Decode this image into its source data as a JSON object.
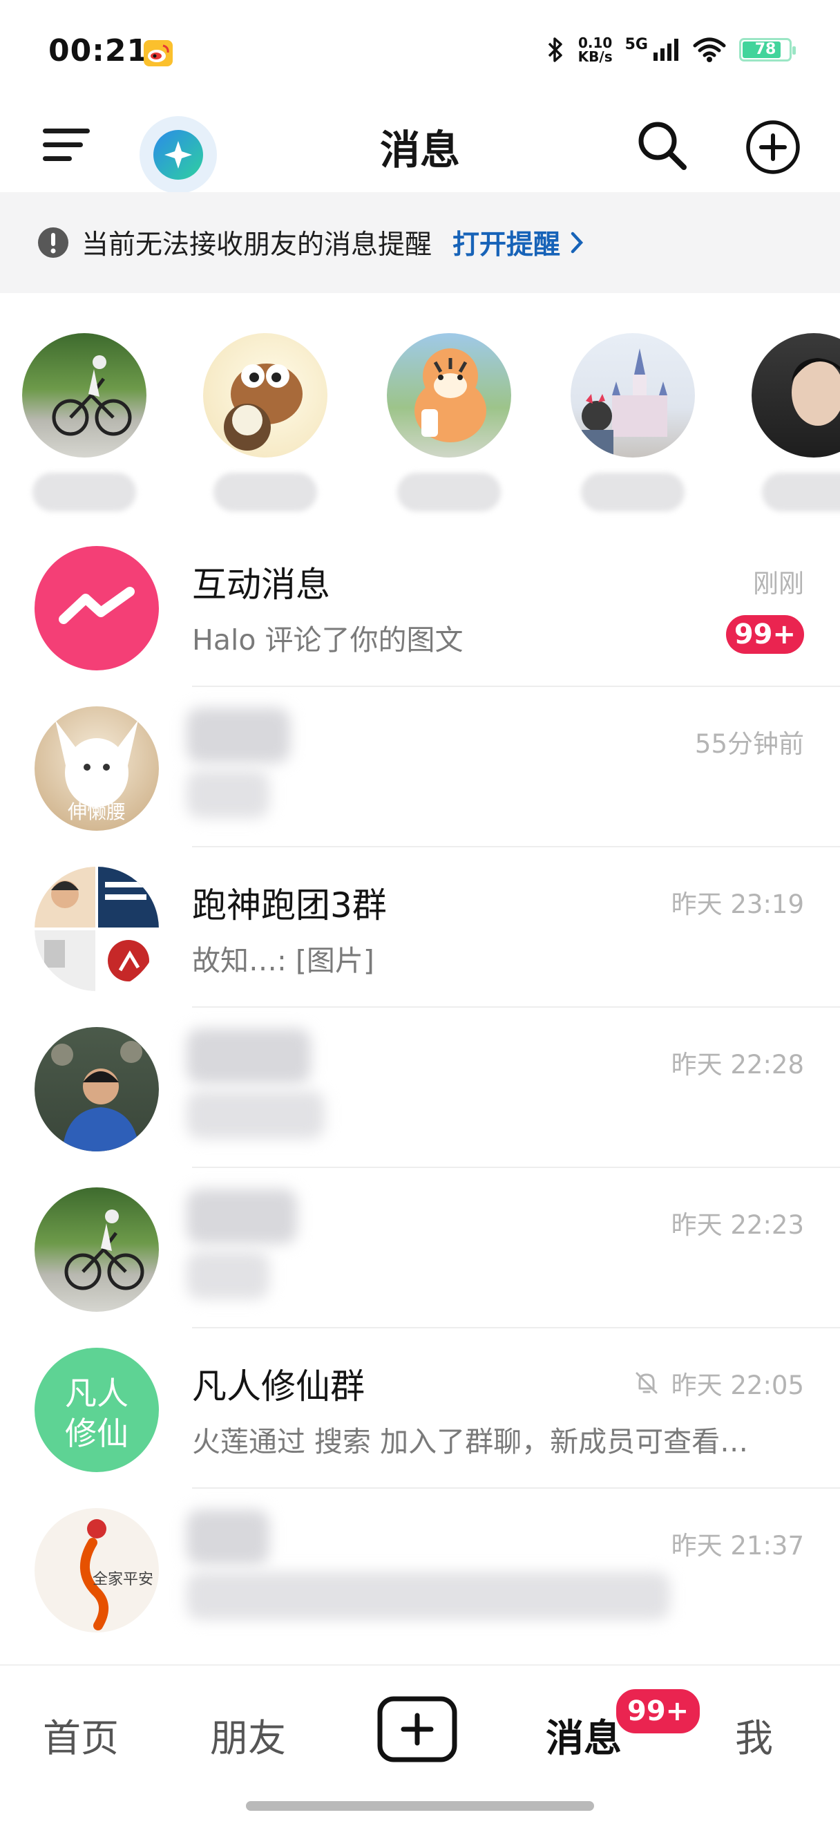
{
  "status_bar": {
    "time": "00:21",
    "speed_value": "0.10",
    "speed_unit": "KB/s",
    "network": "5G",
    "battery": "78"
  },
  "header": {
    "title": "消息"
  },
  "notice": {
    "text": "当前无法接收朋友的消息提醒",
    "action": "打开提醒"
  },
  "conversations": [
    {
      "name": "互动消息",
      "preview": "Halo 评论了你的图文",
      "time": "刚刚",
      "badge": "99+"
    },
    {
      "name": "",
      "preview": "",
      "time": "55分钟前"
    },
    {
      "name": "跑神跑团3群",
      "preview": "故知…: [图片]",
      "time": "昨天 23:19"
    },
    {
      "name": "",
      "preview": "",
      "time": "昨天 22:28"
    },
    {
      "name": "",
      "preview": "",
      "time": "昨天 22:23"
    },
    {
      "name": "凡人修仙群",
      "preview": "火莲通过 搜索 加入了群聊，新成员可查看…",
      "time": "昨天 22:05",
      "avatar_text": "凡人修仙"
    },
    {
      "name": "",
      "preview": "",
      "time": "昨天 21:37"
    }
  ],
  "avatar_overlays": {
    "cat_caption": "伸懒腰",
    "family_caption": "全家平安"
  },
  "bottom_nav": {
    "home": "首页",
    "friends": "朋友",
    "messages": "消息",
    "messages_badge": "99+",
    "me": "我"
  },
  "colors": {
    "accent_red": "#ea2450",
    "link_blue": "#1763b8",
    "interaction_pink": "#f43f76",
    "group_green": "#5ed394"
  }
}
